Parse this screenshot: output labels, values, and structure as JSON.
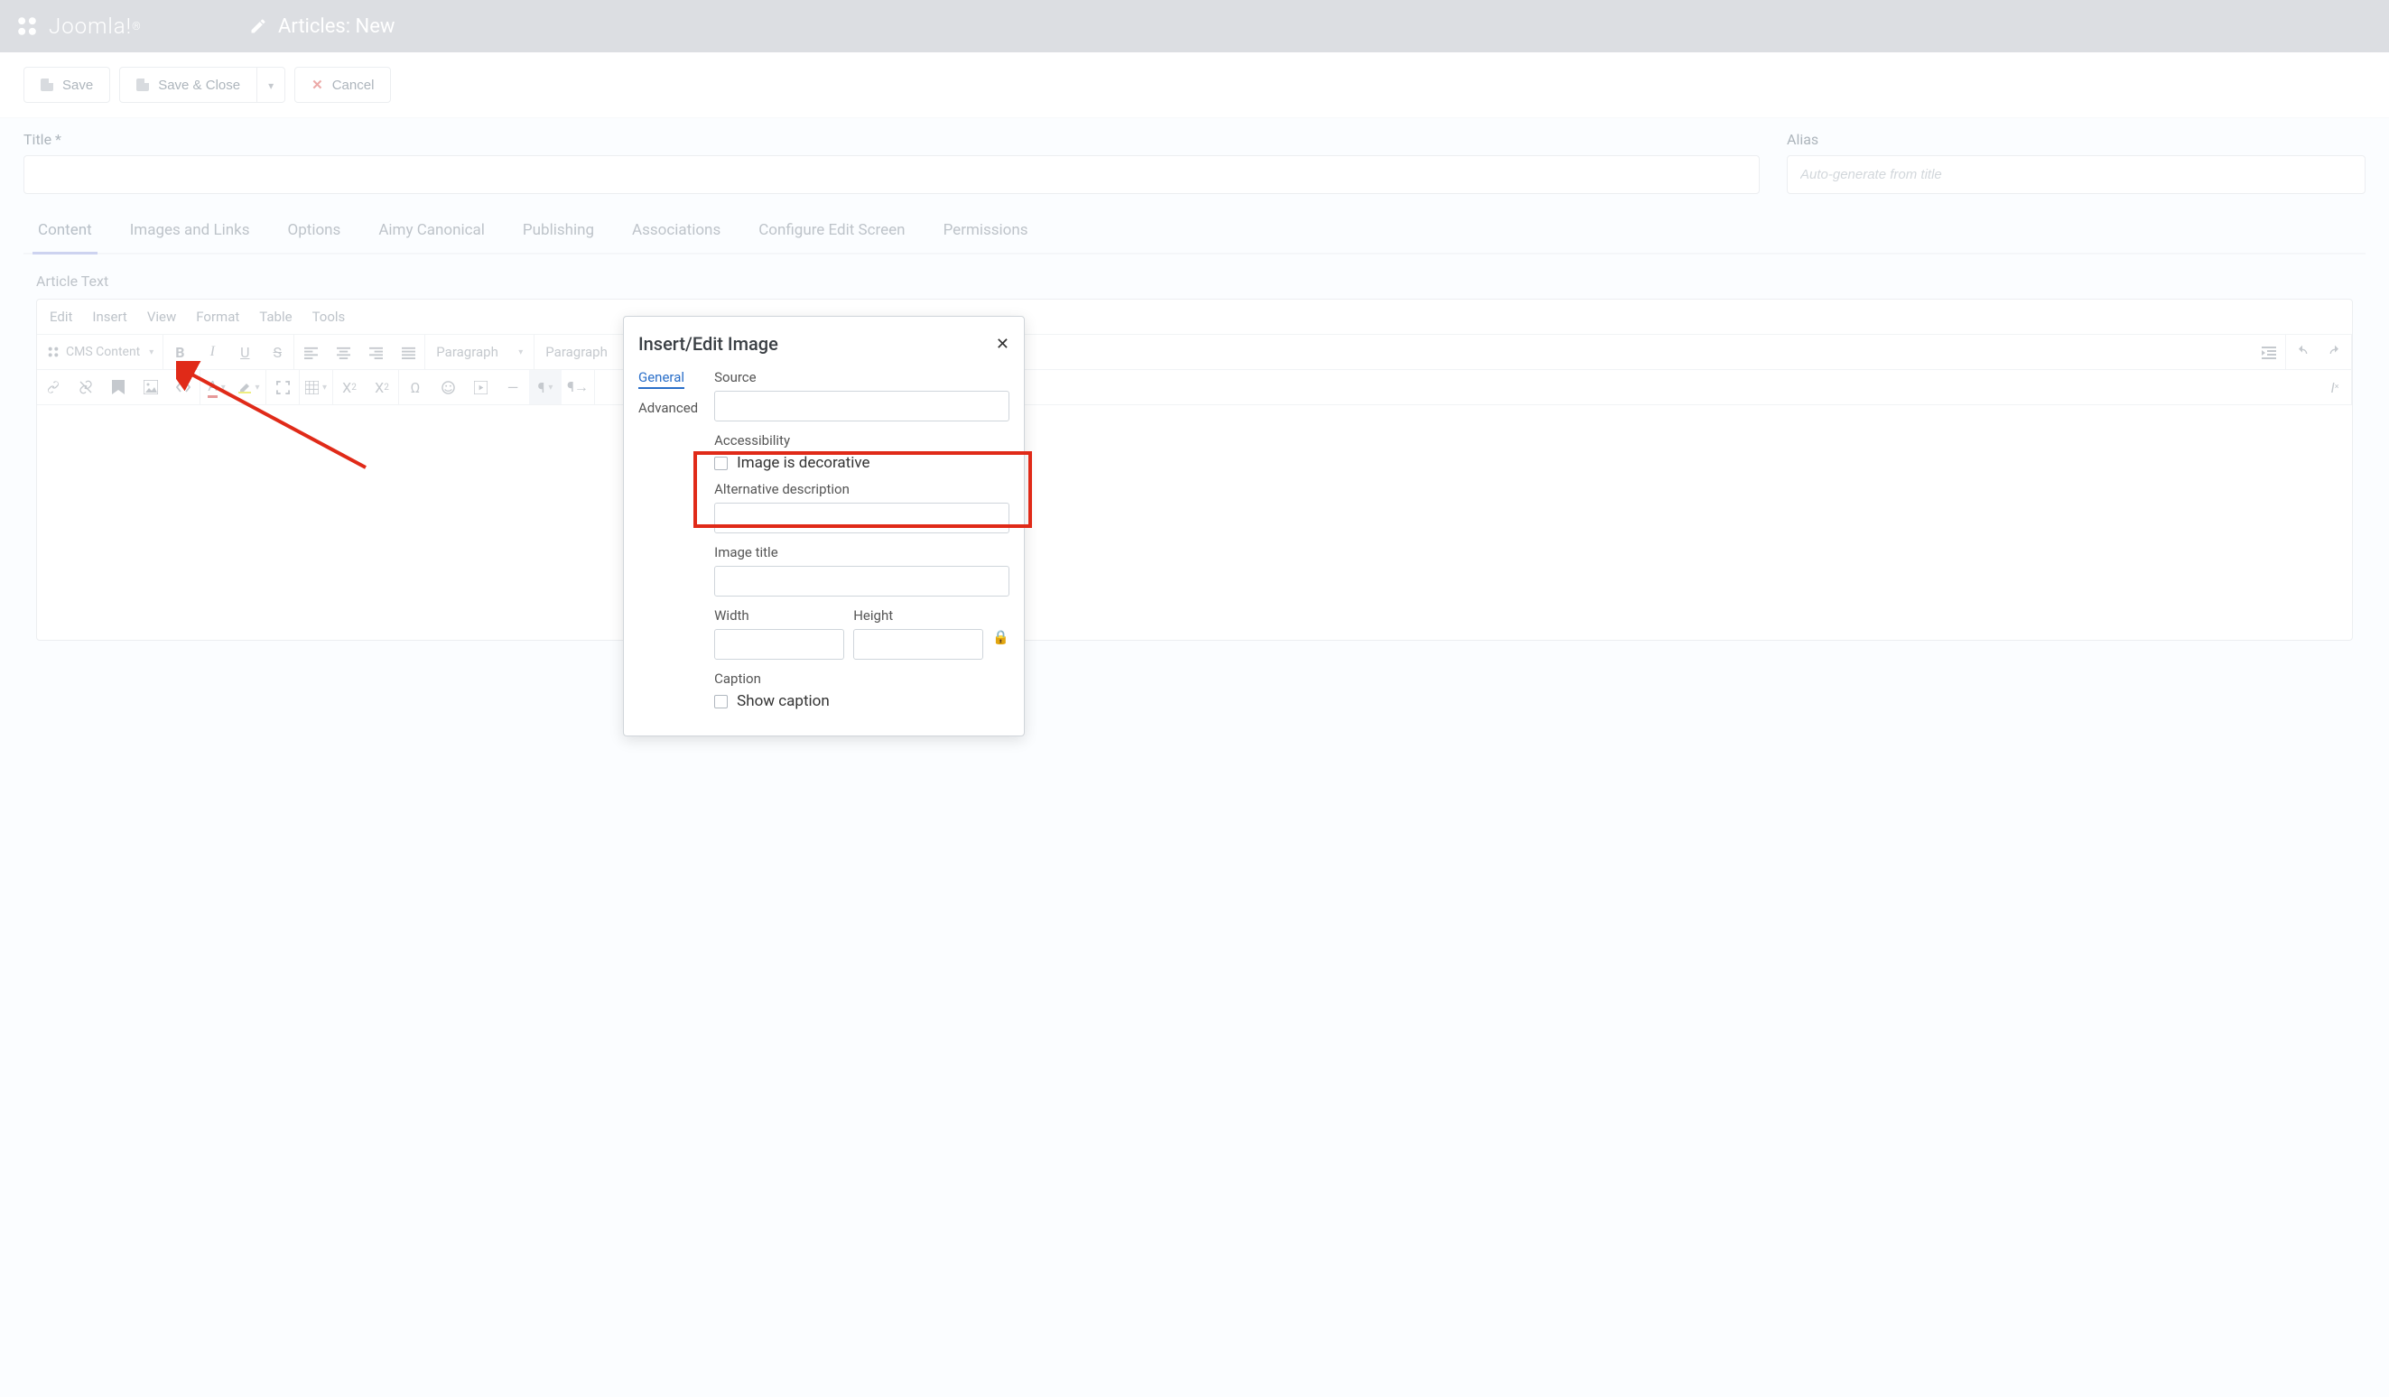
{
  "topbar": {
    "brand": "Joomla!",
    "page_title": "Articles: New"
  },
  "toolbar": {
    "save": "Save",
    "save_close": "Save & Close",
    "cancel": "Cancel"
  },
  "fields": {
    "title_label": "Title *",
    "alias_label": "Alias",
    "alias_placeholder": "Auto-generate from title"
  },
  "tabs": [
    "Content",
    "Images and Links",
    "Options",
    "Aimy Canonical",
    "Publishing",
    "Associations",
    "Configure Edit Screen",
    "Permissions"
  ],
  "editor": {
    "label": "Article Text",
    "menus": [
      "Edit",
      "Insert",
      "View",
      "Format",
      "Table",
      "Tools"
    ],
    "cms_button": "CMS Content",
    "block_sel1": "Paragraph",
    "block_sel2": "Paragraph"
  },
  "dialog": {
    "title": "Insert/Edit Image",
    "tabs": {
      "general": "General",
      "advanced": "Advanced"
    },
    "source_label": "Source",
    "accessibility_label": "Accessibility",
    "decorative_label": "Image is decorative",
    "alt_label": "Alternative description",
    "imgtitle_label": "Image title",
    "width_label": "Width",
    "height_label": "Height",
    "caption_label": "Caption",
    "show_caption_label": "Show caption"
  }
}
